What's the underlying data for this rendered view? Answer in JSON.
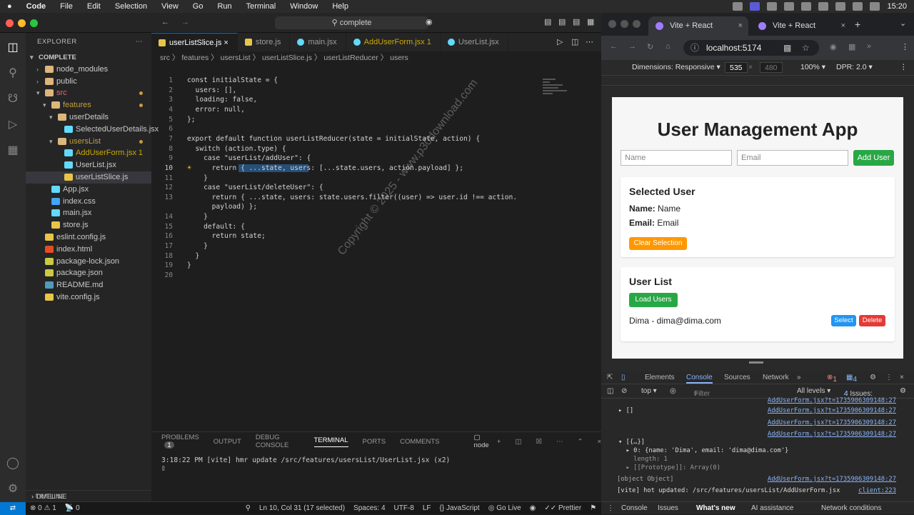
{
  "menubar": {
    "app": "Code",
    "items": [
      "File",
      "Edit",
      "Selection",
      "View",
      "Go",
      "Run",
      "Terminal",
      "Window",
      "Help"
    ],
    "clock": "15:20"
  },
  "vscode": {
    "command_center": "complete",
    "explorer_title": "EXPLORER",
    "root": "COMPLETE",
    "tree": [
      {
        "label": "node_modules",
        "indent": 1,
        "type": "folder",
        "open": false
      },
      {
        "label": "public",
        "indent": 1,
        "type": "folder",
        "open": false
      },
      {
        "label": "src",
        "indent": 1,
        "type": "folder",
        "open": true,
        "dot": true,
        "color": "#e06c75"
      },
      {
        "label": "features",
        "indent": 2,
        "type": "folder",
        "open": true,
        "dot": true,
        "color": "#c59f3a"
      },
      {
        "label": "userDetails",
        "indent": 3,
        "type": "folder",
        "open": true
      },
      {
        "label": "SelectedUserDetails.jsx",
        "indent": 4,
        "type": "file",
        "color": "#c8c8c8"
      },
      {
        "label": "usersList",
        "indent": 3,
        "type": "folder",
        "open": true,
        "dot": true,
        "color": "#c59f3a"
      },
      {
        "label": "AddUserForm.jsx",
        "indent": 4,
        "type": "file",
        "num": "1",
        "color": "#cca700"
      },
      {
        "label": "UserList.jsx",
        "indent": 4,
        "type": "file",
        "color": "#c8c8c8"
      },
      {
        "label": "userListSlice.js",
        "indent": 4,
        "type": "file",
        "selected": true,
        "color": "#c8c8c8"
      },
      {
        "label": "App.jsx",
        "indent": 2,
        "type": "file",
        "color": "#c8c8c8"
      },
      {
        "label": "index.css",
        "indent": 2,
        "type": "file",
        "color": "#c8c8c8"
      },
      {
        "label": "main.jsx",
        "indent": 2,
        "type": "file",
        "color": "#c8c8c8"
      },
      {
        "label": "store.js",
        "indent": 2,
        "type": "file",
        "color": "#c8c8c8"
      },
      {
        "label": "eslint.config.js",
        "indent": 1,
        "type": "file",
        "color": "#c8c8c8"
      },
      {
        "label": "index.html",
        "indent": 1,
        "type": "file",
        "color": "#c8c8c8"
      },
      {
        "label": "package-lock.json",
        "indent": 1,
        "type": "file",
        "color": "#c8c8c8"
      },
      {
        "label": "package.json",
        "indent": 1,
        "type": "file",
        "color": "#c8c8c8"
      },
      {
        "label": "README.md",
        "indent": 1,
        "type": "file",
        "color": "#c8c8c8"
      },
      {
        "label": "vite.config.js",
        "indent": 1,
        "type": "file",
        "color": "#c8c8c8"
      }
    ],
    "outline": "OUTLINE",
    "timeline": "TIMELINE",
    "tabs": [
      {
        "label": "userListSlice.js",
        "active": true
      },
      {
        "label": "store.js",
        "active": false
      },
      {
        "label": "main.jsx",
        "active": false
      },
      {
        "label": "AddUserForm.jsx 1",
        "active": false
      },
      {
        "label": "UserList.jsx",
        "active": false
      }
    ],
    "breadcrumb": "src 〉 features 〉 usersList 〉 userListSlice.js 〉 userListReducer 〉 users",
    "code_lines": [
      "const initialState = {",
      "  users: [],",
      "  loading: false,",
      "  error: null,",
      "};",
      "",
      "export default function userListReducer(state = initialState, action) {",
      "  switch (action.type) {",
      "    case \"userList/addUser\": {",
      "      return { ...state, users: [...state.users, action.payload] };",
      "    }",
      "    case \"userList/deleteUser\": {",
      "      return { ...state, users: state.users.filter((user) => user.id !== action.",
      "      payload) };",
      "    }",
      "    default: {",
      "      return state;",
      "    }",
      "  }",
      "}",
      ""
    ],
    "line_numbers": [
      "1",
      "2",
      "3",
      "4",
      "5",
      "6",
      "7",
      "8",
      "9",
      "10",
      "11",
      "12",
      "13",
      "",
      "14",
      "15",
      "16",
      "17",
      "18",
      "19",
      "20"
    ],
    "panel_tabs": [
      "PROBLEMS",
      "OUTPUT",
      "DEBUG CONSOLE",
      "TERMINAL",
      "PORTS",
      "COMMENTS"
    ],
    "problems_count": "1",
    "terminal_label": "node",
    "terminal_line": "3:18:22 PM [vite] hmr update /src/features/usersList/UserList.jsx (x2)",
    "status": {
      "errors": "0",
      "warnings": "1",
      "ports": "0",
      "position": "Ln 10, Col 31 (17 selected)",
      "spaces": "Spaces: 4",
      "encoding": "UTF-8",
      "eol": "LF",
      "language": "JavaScript",
      "golive": "Go Live",
      "prettier": "Prettier"
    }
  },
  "watermark": "Copyright © 2025 - www.p30download.com",
  "chrome": {
    "tabs": [
      "Vite + React",
      "Vite + React"
    ],
    "url": "localhost:5174",
    "dimensions": "Dimensions: Responsive ▾",
    "width": "535",
    "height": "480",
    "zoom": "100% ▾",
    "dpr": "DPR: 2.0 ▾"
  },
  "app": {
    "title": "User Management App",
    "name_placeholder": "Name",
    "email_placeholder": "Email",
    "add_button": "Add User",
    "selected_title": "Selected User",
    "name_label": "Name:",
    "name_value": "Name",
    "email_label": "Email:",
    "email_value": "Email",
    "clear_button": "Clear Selection",
    "list_title": "User List",
    "load_button": "Load Users",
    "user_entry": "Dima - dima@dima.com",
    "select_button": "Select",
    "delete_button": "Delete",
    "colors": {
      "green": "#28a745",
      "orange": "#ff9800",
      "blue": "#2196f3",
      "red": "#e53935"
    }
  },
  "devtools": {
    "tabs": [
      "Elements",
      "Console",
      "Sources",
      "Network"
    ],
    "errors": "1",
    "messages": "4",
    "context": "top ▾",
    "filter": "Filter",
    "levels": "All levels ▾",
    "issues": "4 Issues:",
    "issues_count": "4",
    "links": [
      "AddUserForm.jsx?t=1735906309148:27",
      "AddUserForm.jsx?t=1735906309148:27",
      "AddUserForm.jsx?t=1735906309148:27",
      "AddUserForm.jsx?t=1735906309148:27",
      "AddUserForm.jsx?t=1735906309148:27"
    ],
    "row_empty_array": "▸ []",
    "row_obj": "▾ [{…}]",
    "row_item": "  ▸ 0: {name: 'Dima', email: 'dima@dima.com'}",
    "row_length": "    length: 1",
    "row_proto": "  ▸ [[Prototype]]: Array(0)",
    "row_object": "[object Object]",
    "row_hot": "[vite] hot updated: /src/features/usersList/AddUserForm.jsx",
    "row_hot_link": "client:223",
    "drawer_tabs": [
      "Console",
      "Issues",
      "What's new",
      "AI assistance",
      "Network conditions"
    ]
  }
}
